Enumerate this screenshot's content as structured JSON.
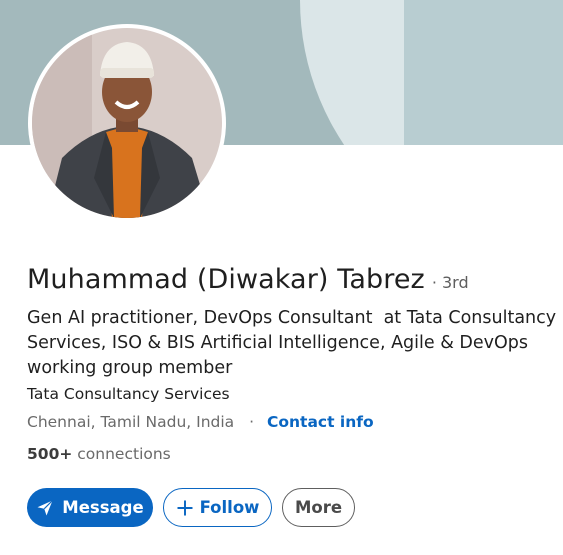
{
  "profile": {
    "name": "Muhammad (Diwakar) Tabrez",
    "degree": "· 3rd",
    "headline": "Gen AI practitioner, DevOps Consultant  at Tata Consultancy Services, ISO & BIS Artificial Intelligence, Agile & DevOps working group member",
    "company": "Tata Consultancy Services",
    "location": "Chennai, Tamil Nadu, India",
    "separator": "·",
    "contact_info": "Contact info",
    "connections_count": "500+",
    "connections_label": "connections"
  },
  "actions": {
    "message_label": "Message",
    "follow_label": "Follow",
    "more_label": "More"
  },
  "icons": {
    "message": "paper-plane-icon",
    "follow": "plus-icon"
  },
  "colors": {
    "accent": "#0a66c2",
    "banner_base": "#a3b9bc",
    "banner_light": "#dbe6e8",
    "banner_panel": "#b8cdd1"
  }
}
